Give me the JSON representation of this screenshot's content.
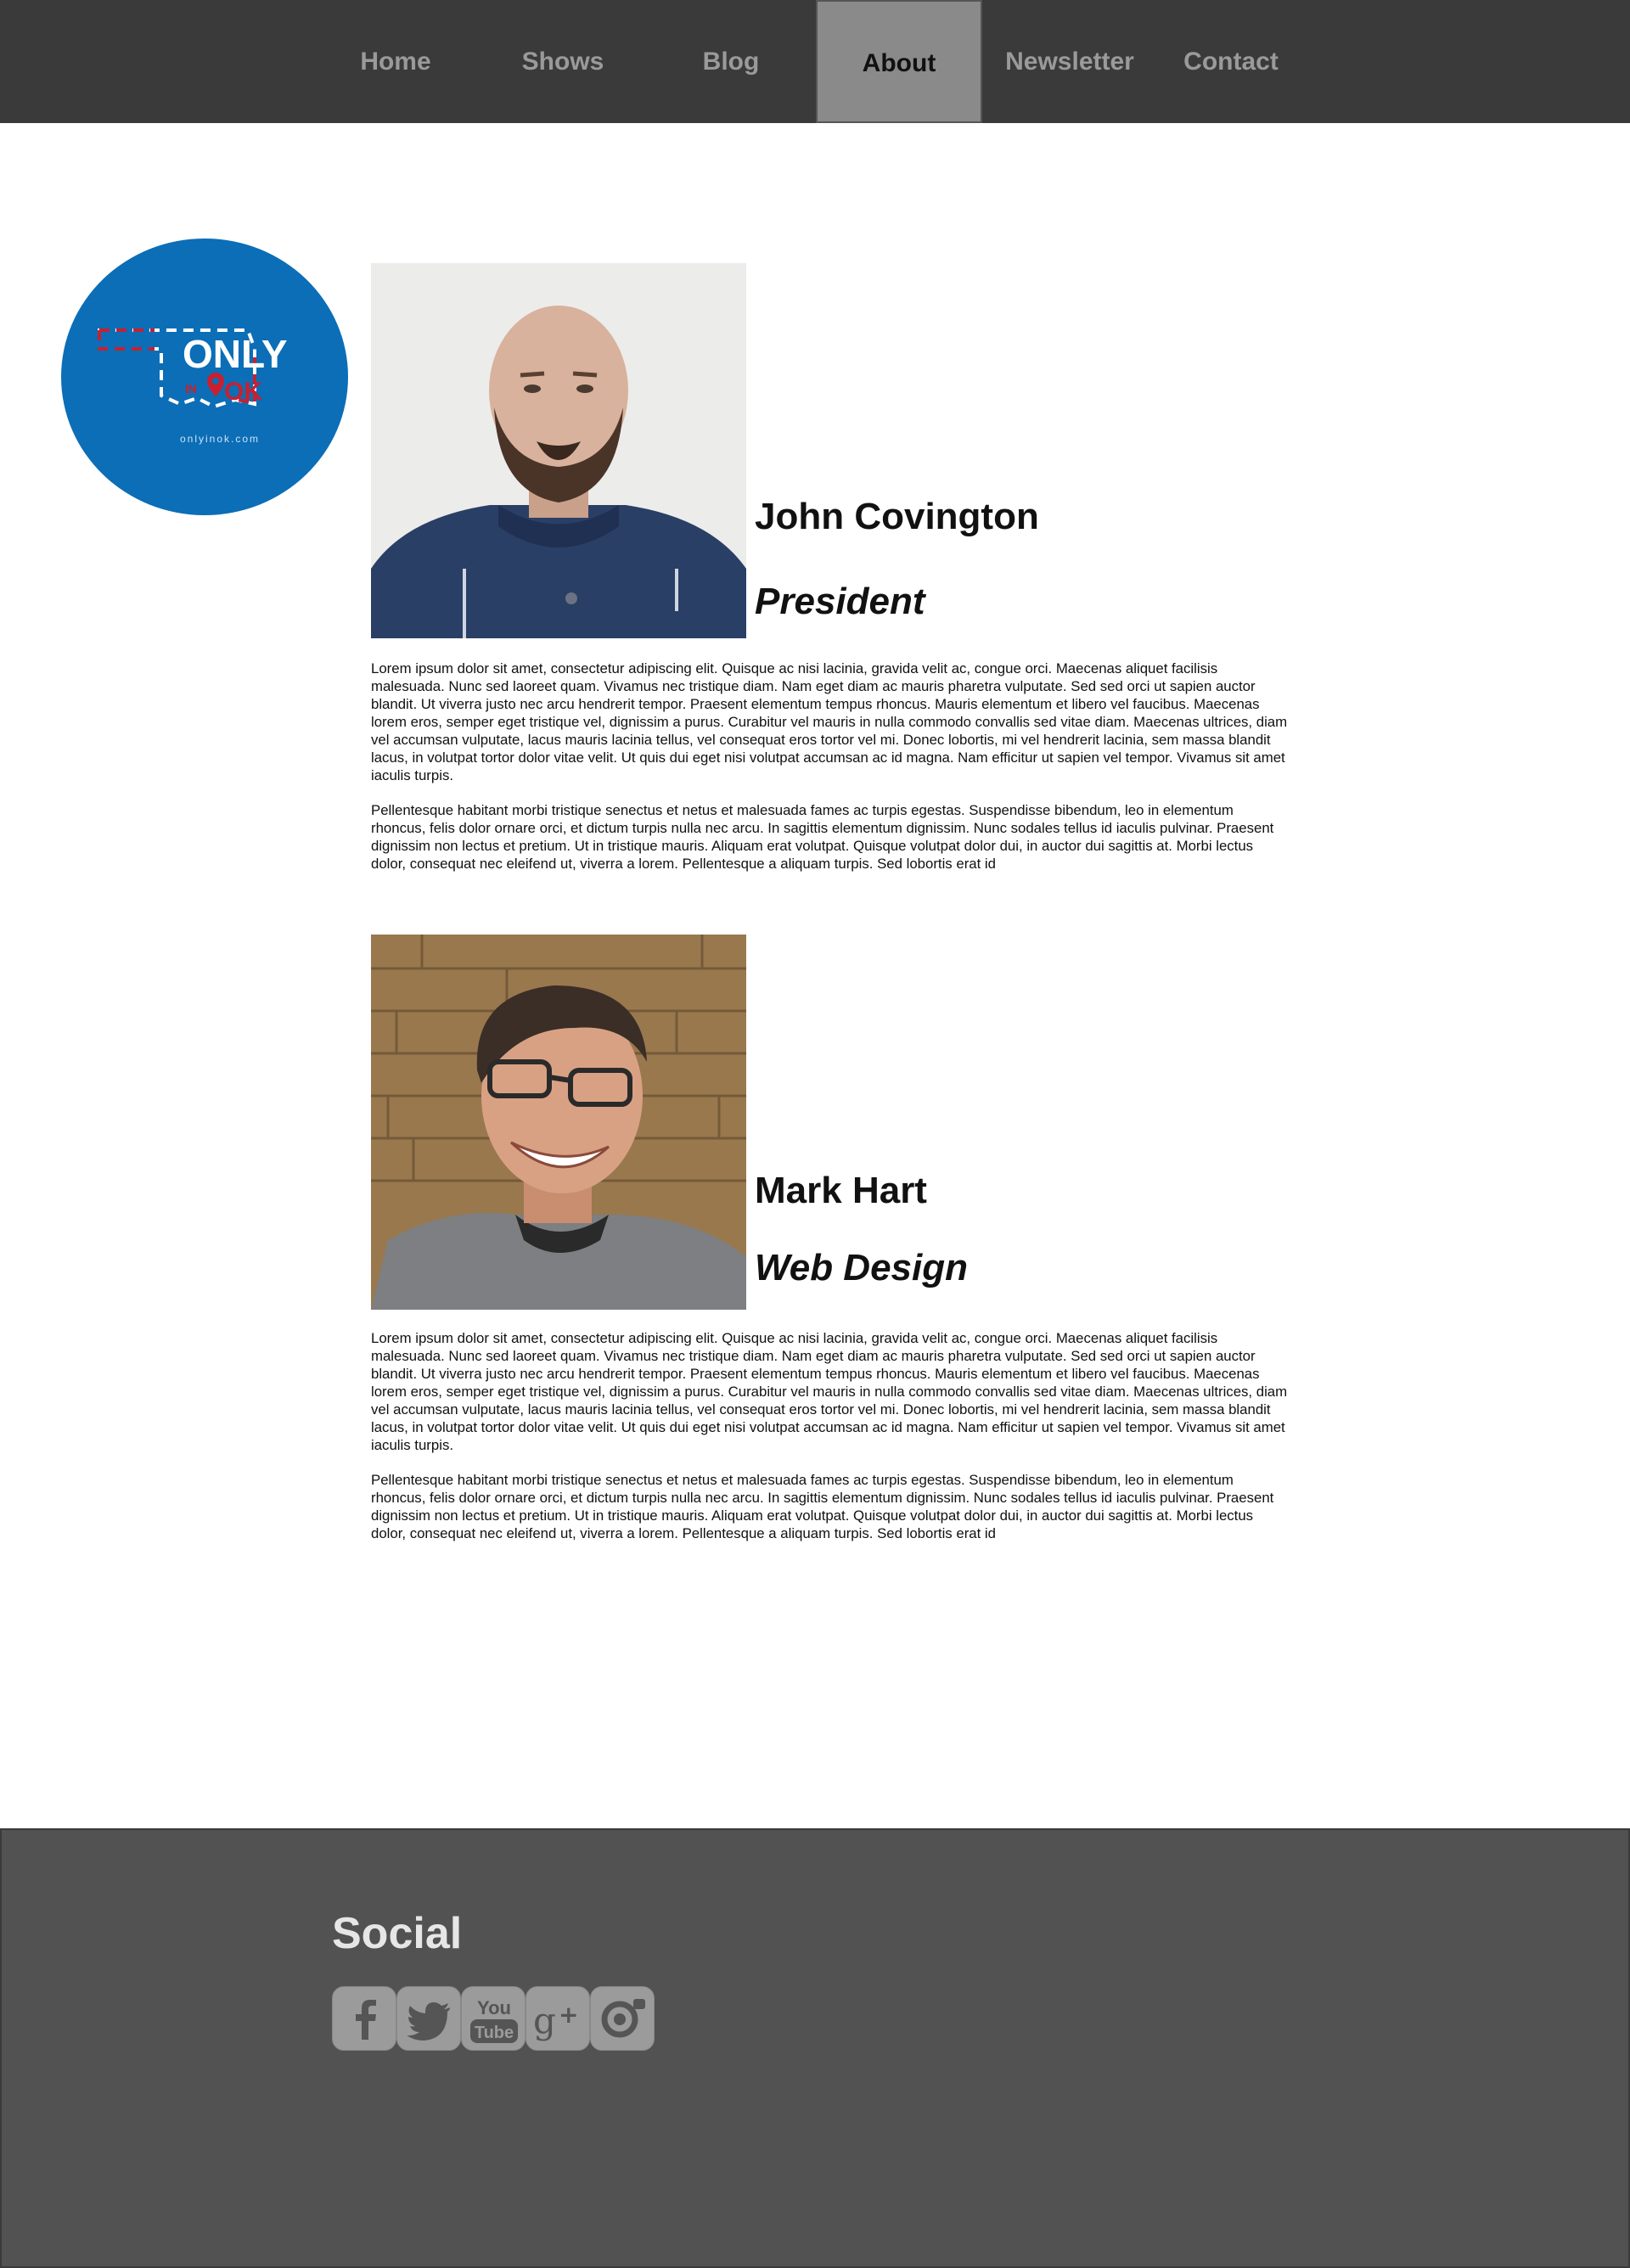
{
  "nav": {
    "items": [
      {
        "label": "Home",
        "active": false
      },
      {
        "label": "Shows",
        "active": false
      },
      {
        "label": "Blog",
        "active": false
      },
      {
        "label": "About",
        "active": true
      },
      {
        "label": "Newsletter",
        "active": false
      },
      {
        "label": "Contact",
        "active": false
      }
    ]
  },
  "logo": {
    "wordmark_top": "ONLY",
    "wordmark_small": "IN",
    "wordmark_bottom": "OK",
    "url_text": "onlyinok.com",
    "colors": {
      "circle": "#0b6eb7",
      "accent": "#c8202f",
      "text": "#ffffff"
    }
  },
  "team": [
    {
      "name": "John Covington",
      "role": "President",
      "photo": "bald-bearded-man-in-blue-hoodie",
      "bio": [
        "Lorem ipsum dolor sit amet, consectetur adipiscing elit. Quisque ac nisi lacinia, gravida velit ac, congue orci. Maecenas aliquet facilisis malesuada. Nunc sed laoreet quam. Vivamus nec tristique diam. Nam eget diam ac mauris pharetra vulputate. Sed sed orci ut sapien auctor blandit. Ut viverra justo nec arcu hendrerit tempor. Praesent elementum tempus rhoncus. Mauris elementum et libero vel faucibus. Maecenas lorem eros, semper eget tristique vel, dignissim a purus. Curabitur vel mauris in nulla commodo convallis sed vitae diam. Maecenas ultrices, diam vel accumsan vulputate, lacus mauris lacinia tellus, vel consequat eros tortor vel mi. Donec lobortis, mi vel hendrerit lacinia, sem massa blandit lacus, in volutpat tortor dolor vitae velit. Ut quis dui eget nisi volutpat accumsan ac id magna. Nam efficitur ut sapien vel tempor. Vivamus sit amet iaculis turpis.",
        "Pellentesque habitant morbi tristique senectus et netus et malesuada fames ac turpis egestas. Suspendisse bibendum, leo in elementum rhoncus, felis dolor ornare orci, et dictum turpis nulla nec arcu. In sagittis elementum dignissim. Nunc sodales tellus id iaculis pulvinar. Praesent dignissim non lectus et pretium. Ut in tristique mauris. Aliquam erat volutpat. Quisque volutpat dolor dui, in auctor dui sagittis at. Morbi lectus dolor, consequat nec eleifend ut, viverra a lorem. Pellentesque a aliquam turpis. Sed lobortis erat id"
      ]
    },
    {
      "name": "Mark Hart",
      "role": "Web Design",
      "photo": "smiling-man-with-glasses-brick-wall",
      "bio": [
        "Lorem ipsum dolor sit amet, consectetur adipiscing elit. Quisque ac nisi lacinia, gravida velit ac, congue orci. Maecenas aliquet facilisis malesuada. Nunc sed laoreet quam. Vivamus nec tristique diam. Nam eget diam ac mauris pharetra vulputate. Sed sed orci ut sapien auctor blandit. Ut viverra justo nec arcu hendrerit tempor. Praesent elementum tempus rhoncus. Mauris elementum et libero vel faucibus. Maecenas lorem eros, semper eget tristique vel, dignissim a purus. Curabitur vel mauris in nulla commodo convallis sed vitae diam. Maecenas ultrices, diam vel accumsan vulputate, lacus mauris lacinia tellus, vel consequat eros tortor vel mi. Donec lobortis, mi vel hendrerit lacinia, sem massa blandit lacus, in volutpat tortor dolor vitae velit. Ut quis dui eget nisi volutpat accumsan ac id magna. Nam efficitur ut sapien vel tempor. Vivamus sit amet iaculis turpis.",
        "Pellentesque habitant morbi tristique senectus et netus et malesuada fames ac turpis egestas. Suspendisse bibendum, leo in elementum rhoncus, felis dolor ornare orci, et dictum turpis nulla nec arcu. In sagittis elementum dignissim. Nunc sodales tellus id iaculis pulvinar. Praesent dignissim non lectus et pretium. Ut in tristique mauris. Aliquam erat volutpat. Quisque volutpat dolor dui, in auctor dui sagittis at. Morbi lectus dolor, consequat nec eleifend ut, viverra a lorem. Pellentesque a aliquam turpis. Sed lobortis erat id"
      ]
    }
  ],
  "footer": {
    "social_title": "Social",
    "icons": [
      "facebook-icon",
      "twitter-icon",
      "youtube-icon",
      "google-plus-icon",
      "instagram-icon"
    ],
    "youtube_top": "You",
    "youtube_bottom": "Tube"
  },
  "colors": {
    "nav_bg": "#3a3a3a",
    "nav_active_bg": "#8a8a8a",
    "nav_text": "#9a9a9a",
    "footer_bg": "#525252",
    "social_icon_bg": "#9b9b9b"
  }
}
